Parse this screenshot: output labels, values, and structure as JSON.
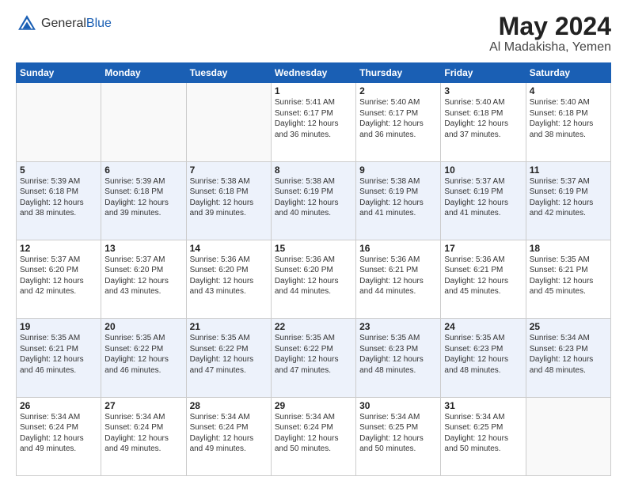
{
  "logo": {
    "general": "General",
    "blue": "Blue"
  },
  "header": {
    "month": "May 2024",
    "location": "Al Madakisha, Yemen"
  },
  "weekdays": [
    "Sunday",
    "Monday",
    "Tuesday",
    "Wednesday",
    "Thursday",
    "Friday",
    "Saturday"
  ],
  "weeks": [
    [
      {
        "day": "",
        "info": ""
      },
      {
        "day": "",
        "info": ""
      },
      {
        "day": "",
        "info": ""
      },
      {
        "day": "1",
        "info": "Sunrise: 5:41 AM\nSunset: 6:17 PM\nDaylight: 12 hours\nand 36 minutes."
      },
      {
        "day": "2",
        "info": "Sunrise: 5:40 AM\nSunset: 6:17 PM\nDaylight: 12 hours\nand 36 minutes."
      },
      {
        "day": "3",
        "info": "Sunrise: 5:40 AM\nSunset: 6:18 PM\nDaylight: 12 hours\nand 37 minutes."
      },
      {
        "day": "4",
        "info": "Sunrise: 5:40 AM\nSunset: 6:18 PM\nDaylight: 12 hours\nand 38 minutes."
      }
    ],
    [
      {
        "day": "5",
        "info": "Sunrise: 5:39 AM\nSunset: 6:18 PM\nDaylight: 12 hours\nand 38 minutes."
      },
      {
        "day": "6",
        "info": "Sunrise: 5:39 AM\nSunset: 6:18 PM\nDaylight: 12 hours\nand 39 minutes."
      },
      {
        "day": "7",
        "info": "Sunrise: 5:38 AM\nSunset: 6:18 PM\nDaylight: 12 hours\nand 39 minutes."
      },
      {
        "day": "8",
        "info": "Sunrise: 5:38 AM\nSunset: 6:19 PM\nDaylight: 12 hours\nand 40 minutes."
      },
      {
        "day": "9",
        "info": "Sunrise: 5:38 AM\nSunset: 6:19 PM\nDaylight: 12 hours\nand 41 minutes."
      },
      {
        "day": "10",
        "info": "Sunrise: 5:37 AM\nSunset: 6:19 PM\nDaylight: 12 hours\nand 41 minutes."
      },
      {
        "day": "11",
        "info": "Sunrise: 5:37 AM\nSunset: 6:19 PM\nDaylight: 12 hours\nand 42 minutes."
      }
    ],
    [
      {
        "day": "12",
        "info": "Sunrise: 5:37 AM\nSunset: 6:20 PM\nDaylight: 12 hours\nand 42 minutes."
      },
      {
        "day": "13",
        "info": "Sunrise: 5:37 AM\nSunset: 6:20 PM\nDaylight: 12 hours\nand 43 minutes."
      },
      {
        "day": "14",
        "info": "Sunrise: 5:36 AM\nSunset: 6:20 PM\nDaylight: 12 hours\nand 43 minutes."
      },
      {
        "day": "15",
        "info": "Sunrise: 5:36 AM\nSunset: 6:20 PM\nDaylight: 12 hours\nand 44 minutes."
      },
      {
        "day": "16",
        "info": "Sunrise: 5:36 AM\nSunset: 6:21 PM\nDaylight: 12 hours\nand 44 minutes."
      },
      {
        "day": "17",
        "info": "Sunrise: 5:36 AM\nSunset: 6:21 PM\nDaylight: 12 hours\nand 45 minutes."
      },
      {
        "day": "18",
        "info": "Sunrise: 5:35 AM\nSunset: 6:21 PM\nDaylight: 12 hours\nand 45 minutes."
      }
    ],
    [
      {
        "day": "19",
        "info": "Sunrise: 5:35 AM\nSunset: 6:21 PM\nDaylight: 12 hours\nand 46 minutes."
      },
      {
        "day": "20",
        "info": "Sunrise: 5:35 AM\nSunset: 6:22 PM\nDaylight: 12 hours\nand 46 minutes."
      },
      {
        "day": "21",
        "info": "Sunrise: 5:35 AM\nSunset: 6:22 PM\nDaylight: 12 hours\nand 47 minutes."
      },
      {
        "day": "22",
        "info": "Sunrise: 5:35 AM\nSunset: 6:22 PM\nDaylight: 12 hours\nand 47 minutes."
      },
      {
        "day": "23",
        "info": "Sunrise: 5:35 AM\nSunset: 6:23 PM\nDaylight: 12 hours\nand 48 minutes."
      },
      {
        "day": "24",
        "info": "Sunrise: 5:35 AM\nSunset: 6:23 PM\nDaylight: 12 hours\nand 48 minutes."
      },
      {
        "day": "25",
        "info": "Sunrise: 5:34 AM\nSunset: 6:23 PM\nDaylight: 12 hours\nand 48 minutes."
      }
    ],
    [
      {
        "day": "26",
        "info": "Sunrise: 5:34 AM\nSunset: 6:24 PM\nDaylight: 12 hours\nand 49 minutes."
      },
      {
        "day": "27",
        "info": "Sunrise: 5:34 AM\nSunset: 6:24 PM\nDaylight: 12 hours\nand 49 minutes."
      },
      {
        "day": "28",
        "info": "Sunrise: 5:34 AM\nSunset: 6:24 PM\nDaylight: 12 hours\nand 49 minutes."
      },
      {
        "day": "29",
        "info": "Sunrise: 5:34 AM\nSunset: 6:24 PM\nDaylight: 12 hours\nand 50 minutes."
      },
      {
        "day": "30",
        "info": "Sunrise: 5:34 AM\nSunset: 6:25 PM\nDaylight: 12 hours\nand 50 minutes."
      },
      {
        "day": "31",
        "info": "Sunrise: 5:34 AM\nSunset: 6:25 PM\nDaylight: 12 hours\nand 50 minutes."
      },
      {
        "day": "",
        "info": ""
      }
    ]
  ]
}
